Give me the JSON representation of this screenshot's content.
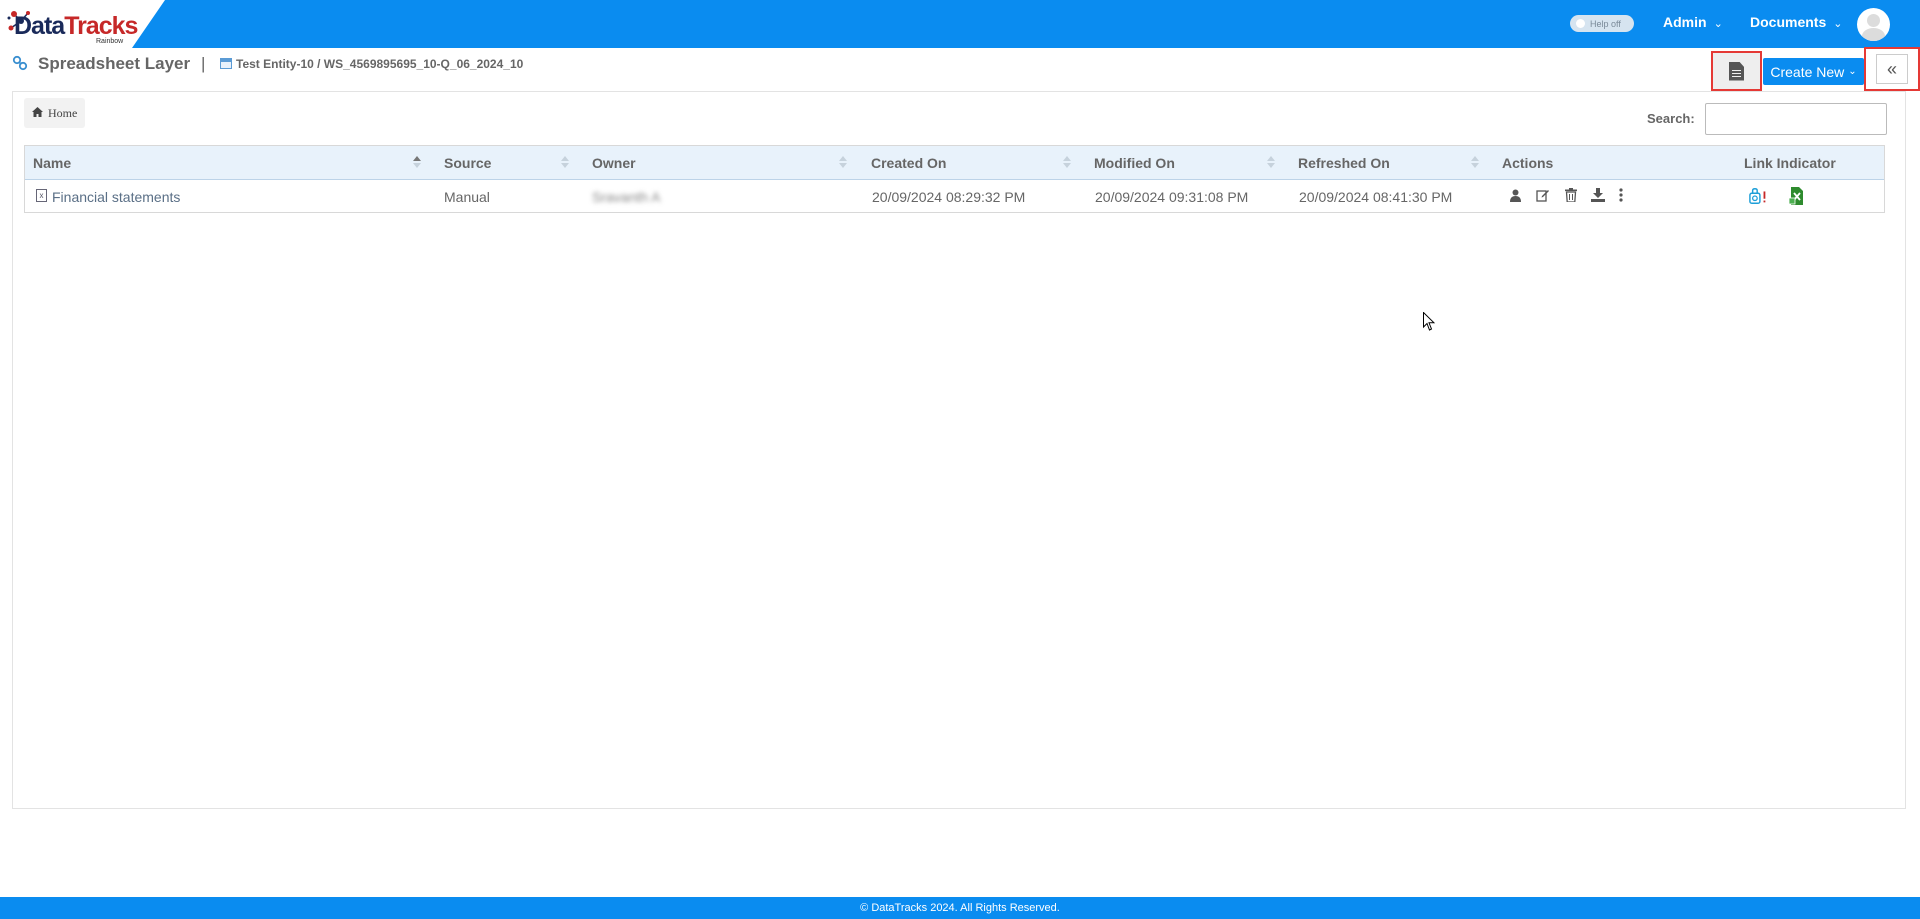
{
  "brand": {
    "name_part1": "Data",
    "name_part2": "Tracks",
    "subtitle": "Rainbow"
  },
  "topnav": {
    "help_toggle_label": "Help off",
    "menus": [
      {
        "label": "Admin"
      },
      {
        "label": "Documents"
      }
    ]
  },
  "header": {
    "title": "Spreadsheet Layer",
    "separator": "|",
    "breadcrumb_path": "Test Entity-10 / WS_4569895695_10-Q_06_2024_10",
    "create_new_label": "Create New",
    "collapse_glyph": "«"
  },
  "toolbar": {
    "home_label": "Home",
    "search_label": "Search:",
    "search_value": ""
  },
  "table": {
    "columns": [
      "Name",
      "Source",
      "Owner",
      "Created On",
      "Modified On",
      "Refreshed On",
      "Actions",
      "Link Indicator"
    ],
    "rows": [
      {
        "name": "Financial statements",
        "source": "Manual",
        "owner": "Sravanth A",
        "created_on": "20/09/2024 08:29:32 PM",
        "modified_on": "20/09/2024 09:31:08 PM",
        "refreshed_on": "20/09/2024 08:41:30 PM"
      }
    ],
    "row_actions": [
      "user-icon",
      "edit-icon",
      "trash-icon",
      "download-icon",
      "more-vertical-icon"
    ],
    "link_indicators": [
      "linked-warning-icon",
      "excel-link-icon"
    ]
  },
  "footer": {
    "copyright": "© DataTracks 2024. All Rights Reserved."
  },
  "colors": {
    "primary": "#0a8cf0",
    "highlight": "#e53935",
    "header_bg": "#e8f2fb"
  }
}
